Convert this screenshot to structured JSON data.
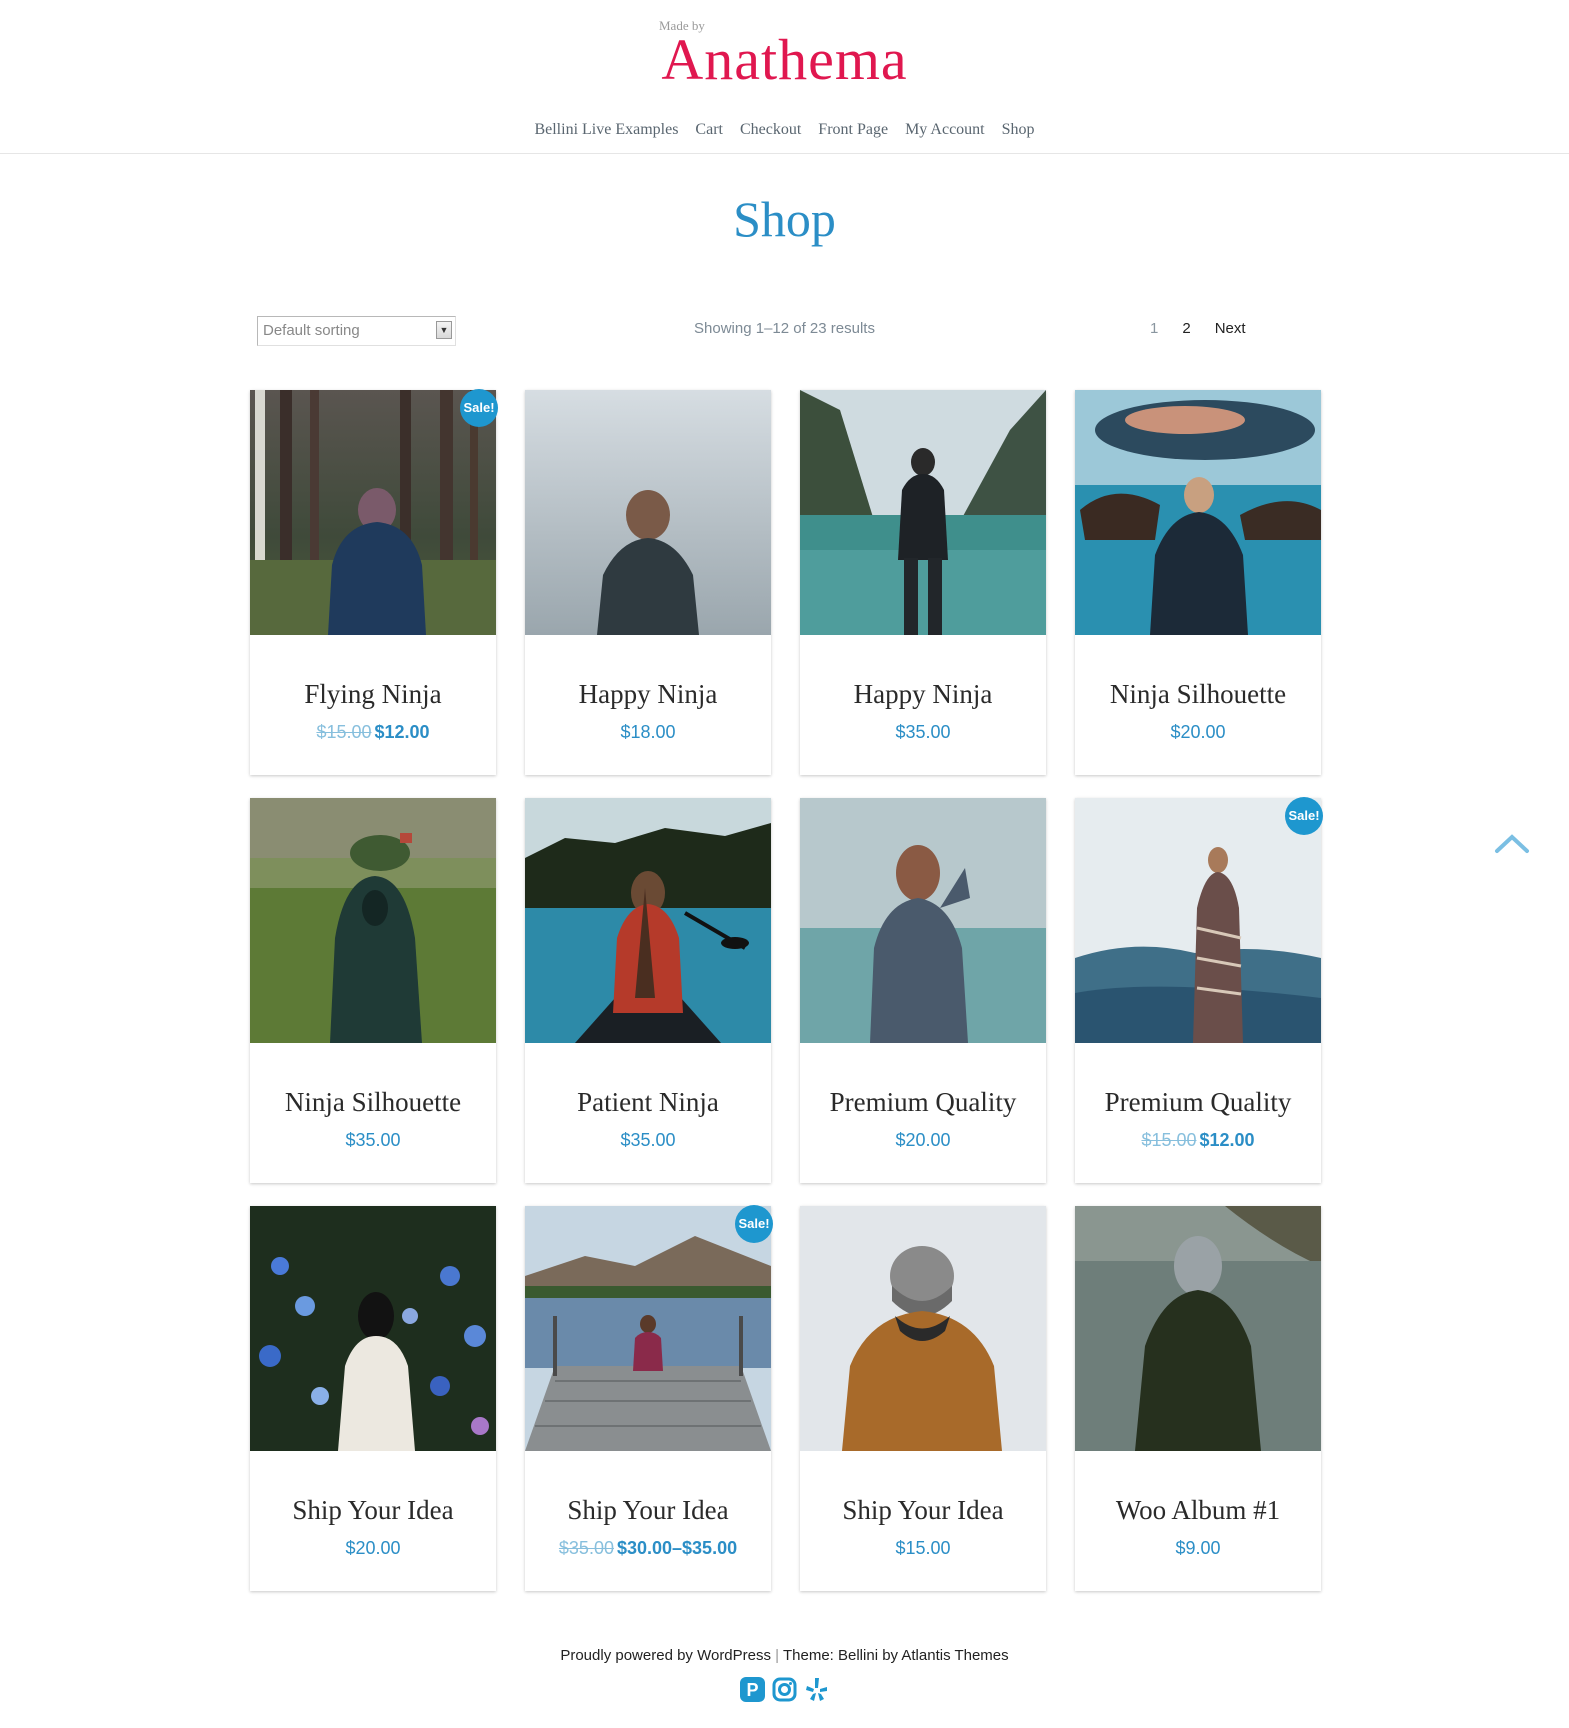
{
  "header": {
    "made_by": "Made by",
    "site_name": "Anathema",
    "nav": [
      "Bellini Live Examples",
      "Cart",
      "Checkout",
      "Front Page",
      "My Account",
      "Shop"
    ]
  },
  "page": {
    "title": "Shop",
    "sort_selected": "Default sorting",
    "result_count": "Showing 1–12 of 23 results",
    "pagination": {
      "page1": "1",
      "page2": "2",
      "next": "Next"
    }
  },
  "products": [
    {
      "name": "Flying Ninja",
      "price_old": "$15.00",
      "price": "$12.00",
      "sale": "Sale!"
    },
    {
      "name": "Happy Ninja",
      "price": "$18.00"
    },
    {
      "name": "Happy Ninja",
      "price": "$35.00"
    },
    {
      "name": "Ninja Silhouette",
      "price": "$20.00"
    },
    {
      "name": "Ninja Silhouette",
      "price": "$35.00"
    },
    {
      "name": "Patient Ninja",
      "price": "$35.00"
    },
    {
      "name": "Premium Quality",
      "price": "$20.00"
    },
    {
      "name": "Premium Quality",
      "price_old": "$15.00",
      "price": "$12.00",
      "sale": "Sale!"
    },
    {
      "name": "Ship Your Idea",
      "price": "$20.00"
    },
    {
      "name": "Ship Your Idea",
      "price_old": "$35.00",
      "price": "$30.00–$35.00",
      "sale": "Sale!"
    },
    {
      "name": "Ship Your Idea",
      "price": "$15.00"
    },
    {
      "name": "Woo Album #1",
      "price": "$9.00"
    }
  ],
  "footer": {
    "powered": "Proudly powered by WordPress",
    "separator": "|",
    "theme": "Theme: Bellini by Atlantis Themes",
    "social_icons": [
      "pinterest-icon",
      "instagram-icon",
      "yelp-icon"
    ]
  },
  "colors": {
    "brand": "#e0174f",
    "accent": "#2b8ec6",
    "badge": "#1e97cf"
  }
}
